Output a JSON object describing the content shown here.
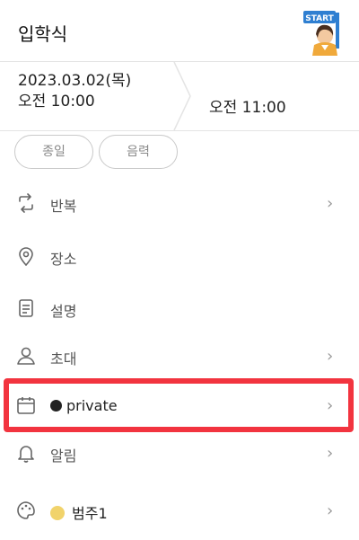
{
  "header": {
    "title": "입학식"
  },
  "date_range": {
    "start_date": "2023.03.02(목)",
    "start_time": "오전 10:00",
    "end_time": "오전 11:00"
  },
  "options": {
    "all_day": "종일",
    "lunar": "음력"
  },
  "rows": [
    {
      "name": "repeat",
      "label": "반복",
      "icon": "repeat-icon",
      "has_chevron": true
    },
    {
      "name": "location",
      "label": "장소",
      "icon": "location-pin-icon",
      "has_chevron": false
    },
    {
      "name": "description",
      "label": "설명",
      "icon": "document-icon",
      "has_chevron": false
    },
    {
      "name": "invite",
      "label": "초대",
      "icon": "person-icon",
      "has_chevron": true
    },
    {
      "name": "calendar",
      "label": "private",
      "icon": "calendar-icon",
      "dot_color": "#222222",
      "has_chevron": true
    },
    {
      "name": "alarm",
      "label": "알림",
      "icon": "bell-icon",
      "has_chevron": true
    },
    {
      "name": "color",
      "label": "범주1",
      "icon": "palette-icon",
      "dot_color": "#f1d36b",
      "has_chevron": true
    }
  ],
  "highlight_color": "#f2343f",
  "chevron": "›"
}
